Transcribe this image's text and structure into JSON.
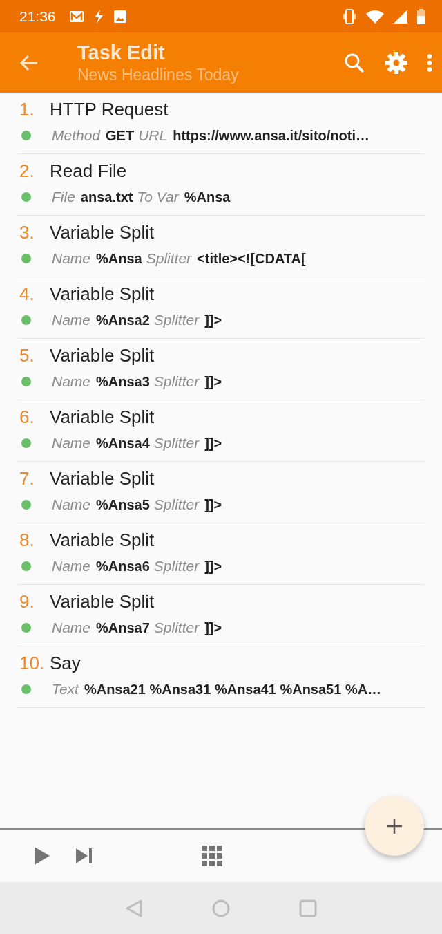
{
  "status_bar": {
    "time": "21:36"
  },
  "app_bar": {
    "title": "Task Edit",
    "subtitle": "News Headlines Today"
  },
  "actions": [
    {
      "number": "1.",
      "name": "HTTP Request",
      "color": "#6abf69",
      "params": [
        {
          "label": "Method",
          "value": "GET"
        },
        {
          "label": "URL",
          "value": "https://www.ansa.it/sito/noti…"
        }
      ]
    },
    {
      "number": "2.",
      "name": "Read File",
      "color": "#6abf69",
      "params": [
        {
          "label": "File",
          "value": "ansa.txt"
        },
        {
          "label": "To Var",
          "value": "%Ansa"
        }
      ]
    },
    {
      "number": "3.",
      "name": "Variable Split",
      "color": "#6abf69",
      "params": [
        {
          "label": "Name",
          "value": "%Ansa"
        },
        {
          "label": "Splitter",
          "value": "<title><![CDATA["
        }
      ]
    },
    {
      "number": "4.",
      "name": "Variable Split",
      "color": "#6abf69",
      "params": [
        {
          "label": "Name",
          "value": "%Ansa2"
        },
        {
          "label": "Splitter",
          "value": "]]>"
        }
      ]
    },
    {
      "number": "5.",
      "name": "Variable Split",
      "color": "#6abf69",
      "params": [
        {
          "label": "Name",
          "value": "%Ansa3"
        },
        {
          "label": "Splitter",
          "value": "]]>"
        }
      ]
    },
    {
      "number": "6.",
      "name": "Variable Split",
      "color": "#6abf69",
      "params": [
        {
          "label": "Name",
          "value": "%Ansa4"
        },
        {
          "label": "Splitter",
          "value": "]]>"
        }
      ]
    },
    {
      "number": "7.",
      "name": "Variable Split",
      "color": "#6abf69",
      "params": [
        {
          "label": "Name",
          "value": "%Ansa5"
        },
        {
          "label": "Splitter",
          "value": "]]>"
        }
      ]
    },
    {
      "number": "8.",
      "name": "Variable Split",
      "color": "#6abf69",
      "params": [
        {
          "label": "Name",
          "value": "%Ansa6"
        },
        {
          "label": "Splitter",
          "value": "]]>"
        }
      ]
    },
    {
      "number": "9.",
      "name": "Variable Split",
      "color": "#6abf69",
      "params": [
        {
          "label": "Name",
          "value": "%Ansa7"
        },
        {
          "label": "Splitter",
          "value": "]]>"
        }
      ]
    },
    {
      "number": "10.",
      "name": "Say",
      "color": "#6abf69",
      "params": [
        {
          "label": "Text",
          "value": "%Ansa21 %Ansa31 %Ansa41 %Ansa51 %A…"
        }
      ]
    }
  ]
}
